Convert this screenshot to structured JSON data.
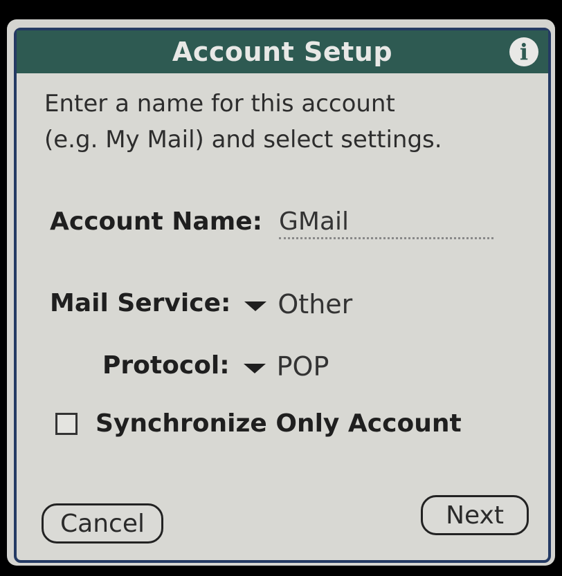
{
  "window": {
    "title": "Account Setup",
    "info_icon": "i"
  },
  "instructions": {
    "line1": "Enter a name for this account",
    "line2": "(e.g. My Mail) and select settings."
  },
  "account_name": {
    "label": "Account Name:",
    "value": "GMail"
  },
  "mail_service": {
    "label": "Mail Service:",
    "selected": "Other"
  },
  "protocol": {
    "label": "Protocol:",
    "selected": "POP"
  },
  "sync_only": {
    "label": "Synchronize Only Account",
    "checked": false
  },
  "buttons": {
    "cancel": "Cancel",
    "next": "Next"
  },
  "icons": [
    "info-icon",
    "chevron-down-icon",
    "checkbox"
  ],
  "colors": {
    "title_bar": "#2e5a52",
    "frame": "#243a63",
    "background": "#d8d8d3"
  }
}
